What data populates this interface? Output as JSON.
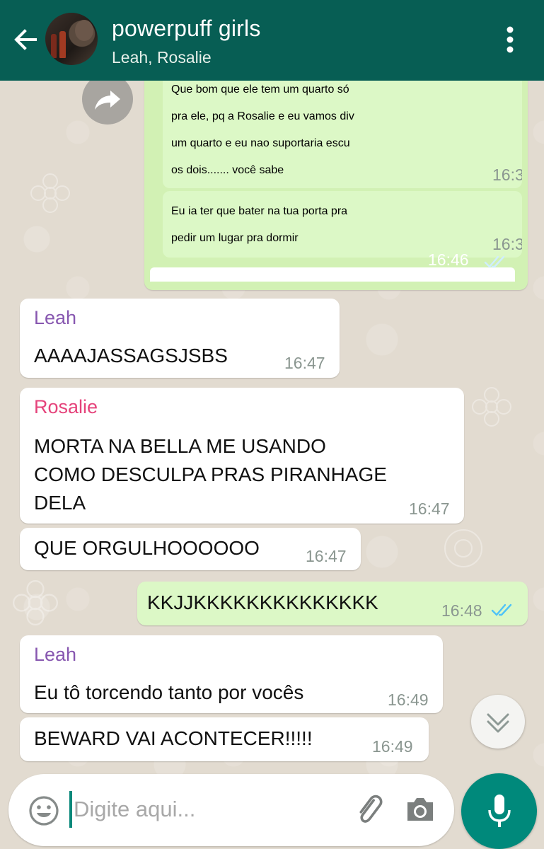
{
  "header": {
    "title": "powerpuff girls",
    "subtitle": "Leah, Rosalie",
    "color": "#075e54"
  },
  "quoted": {
    "message1": [
      "Que bom que ele tem um quarto só",
      "pra ele, pq a Rosalie e eu vamos div",
      "um quarto e eu nao suportaria escu",
      "os dois....... você sabe"
    ],
    "message1_time": "16:3",
    "message2": [
      "Eu ia ter que bater na tua porta pra",
      "pedir um lugar pra dormir"
    ],
    "message2_time": "16:3",
    "group_time": "16:46"
  },
  "messages": [
    {
      "sender": "Leah",
      "sender_color": "#8757b0",
      "lines": [
        "AAAAJASSAGSJSBS"
      ],
      "time": "16:47",
      "direction": "in"
    },
    {
      "sender": "Rosalie",
      "sender_color": "#e5437b",
      "lines": [
        "MORTA NA BELLA ME USANDO",
        "COMO DESCULPA PRAS PIRANHAGE",
        "DELA"
      ],
      "time": "16:47",
      "direction": "in"
    },
    {
      "lines": [
        "QUE ORGULHOOOOOO"
      ],
      "time": "16:47",
      "direction": "in"
    },
    {
      "lines": [
        "KKJJKKKKKKKKKKKKKK"
      ],
      "time": "16:48",
      "direction": "out",
      "status": "read"
    },
    {
      "sender": "Leah",
      "sender_color": "#8757b0",
      "lines": [
        "Eu tô torcendo tanto por vocês"
      ],
      "time": "16:49",
      "direction": "in"
    },
    {
      "lines": [
        "BEWARD VAI ACONTECER!!!!!"
      ],
      "time": "16:49",
      "direction": "in"
    }
  ],
  "composer": {
    "placeholder": "Digite aqui..."
  },
  "icons": {
    "back": "arrow-left-icon",
    "menu": "more-vertical-icon",
    "forward": "forward-icon",
    "scroll": "chevron-down-icon",
    "emoji": "emoji-icon",
    "attach": "paperclip-icon",
    "camera": "camera-icon",
    "mic": "microphone-icon"
  },
  "colors": {
    "incoming_bubble": "#ffffff",
    "outgoing_bubble": "#dcf8c6",
    "read_ticks": "#4fc3f7",
    "mic_button": "#00897b"
  }
}
